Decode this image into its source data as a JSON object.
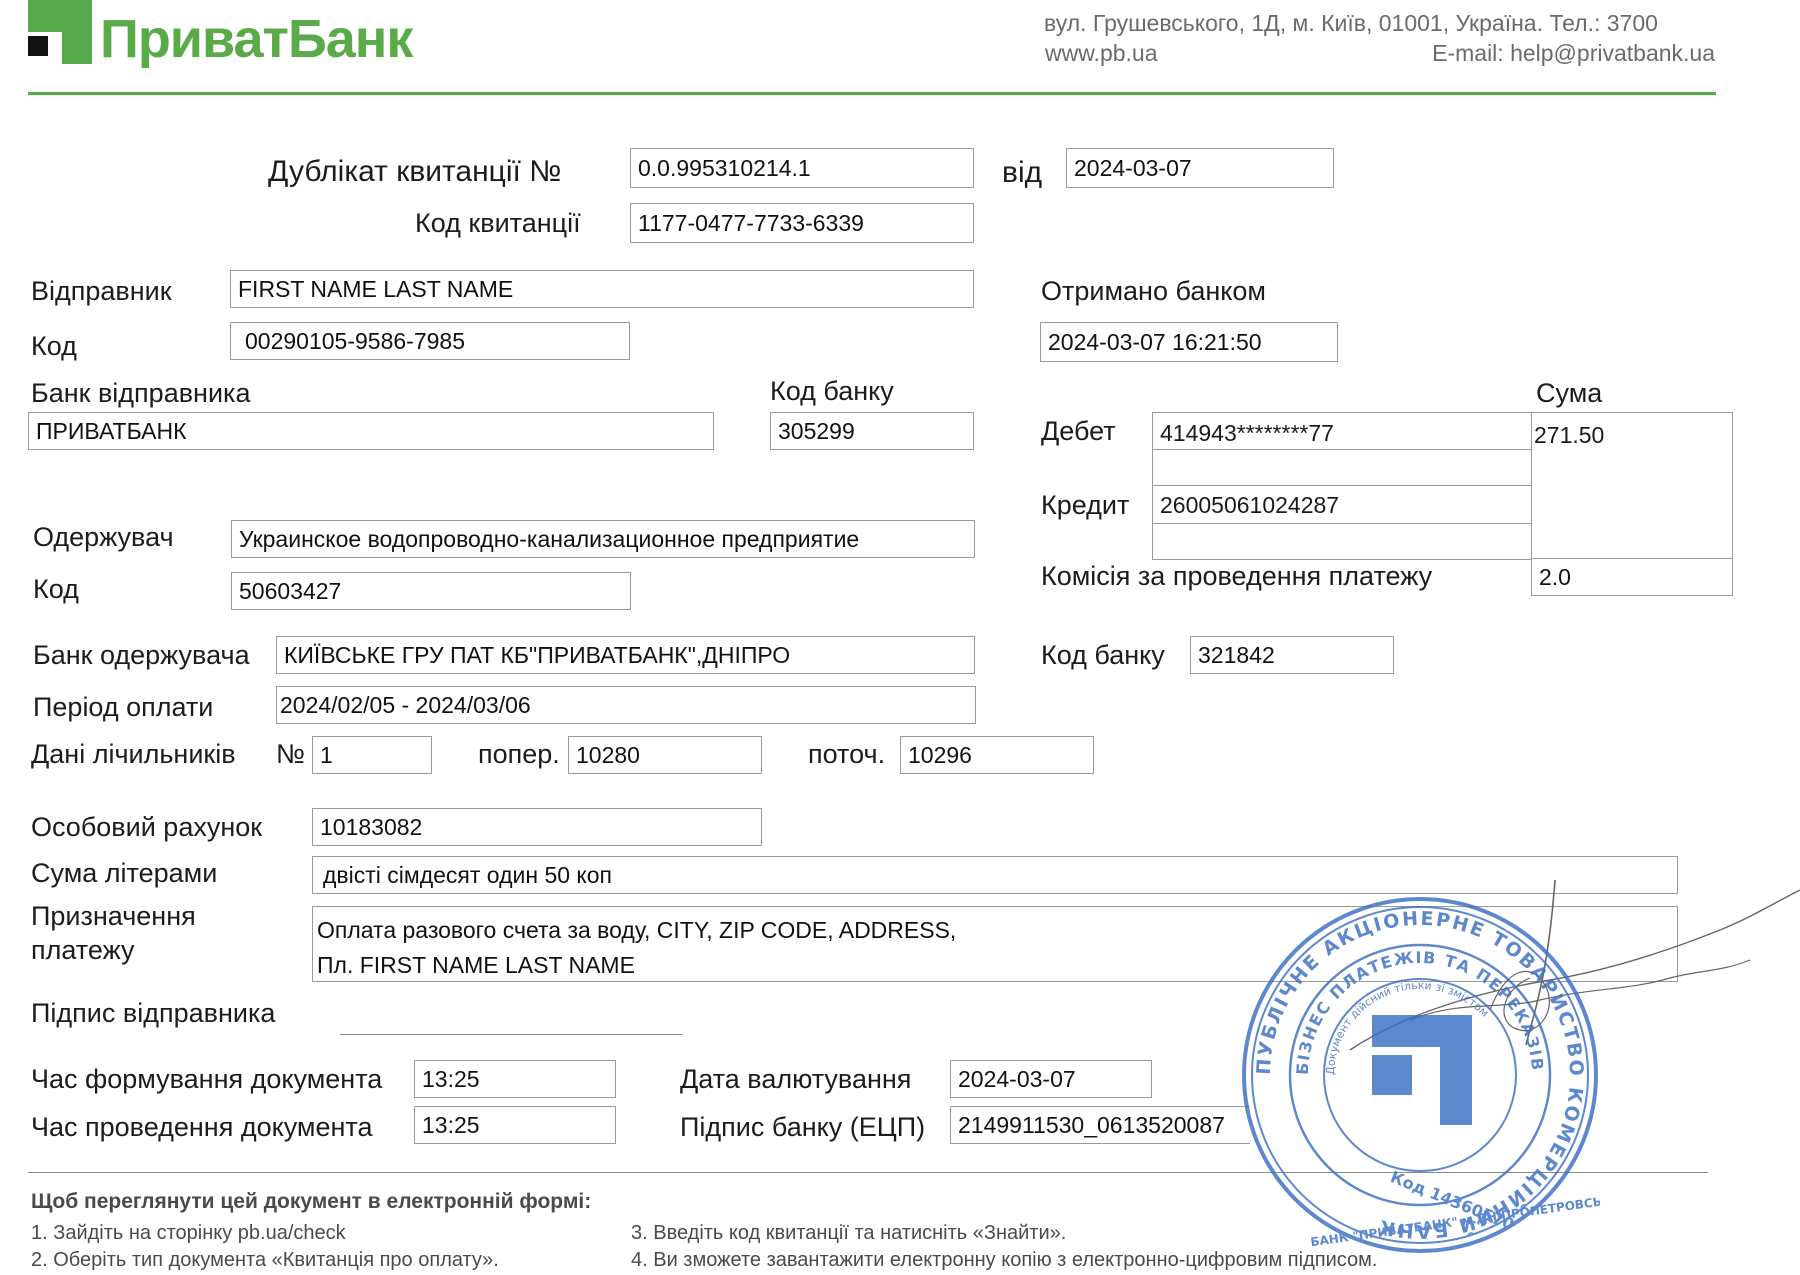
{
  "header": {
    "brand": "ПриватБанк",
    "address": "вул. Грушевського, 1Д, м. Київ, 01001, Україна. Тел.: 3700",
    "website": "www.pb.ua",
    "email": "E-mail: help@privatbank.ua"
  },
  "receipt": {
    "title_label": "Дублікат квитанції №",
    "number": "0.0.995310214.1",
    "from_label": "від",
    "date": "2024-03-07",
    "code_label": "Код квитанції",
    "code": "1177-0477-7733-6339"
  },
  "sender": {
    "label": "Відправник",
    "name": "FIRST NAME LAST NAME",
    "code_label": "Код",
    "code": "00290105-9586-7985",
    "bank_label": "Банк відправника",
    "bank": "ПРИВАТБАНК",
    "bank_code_label": "Код банку",
    "bank_code": "305299"
  },
  "received": {
    "label": "Отримано банком",
    "datetime": "2024-03-07 16:21:50"
  },
  "amounts": {
    "sum_label": "Сума",
    "debit_label": "Дебет",
    "debit": "414943********77",
    "sum": "271.50",
    "credit_label": "Кредит",
    "credit": "26005061024287",
    "commission_label": "Комісія за проведення платежу",
    "commission": "2.0"
  },
  "recipient": {
    "label": "Одержувач",
    "name": "Украинское водопроводно-канализационное предприятие",
    "code_label": "Код",
    "code": "50603427",
    "bank_label": "Банк одержувача",
    "bank": "КИЇВСЬКЕ ГРУ ПАТ КБ\"ПРИВАТБАНК\",ДНІПРО",
    "bank_code_label": "Код банку",
    "bank_code": "321842"
  },
  "payment": {
    "period_label": "Період оплати",
    "period": "2024/02/05 - 2024/03/06",
    "meter_label": "Дані лічильників",
    "meter_no_label": "№",
    "meter_no": "1",
    "prev_label": "попер.",
    "prev": "10280",
    "curr_label": "поточ.",
    "curr": "10296",
    "account_label": "Особовий рахунок",
    "account": "10183082",
    "words_label": "Сума літерами",
    "words": "двісті сімдесят один 50 коп",
    "purpose_label_1": "Призначення",
    "purpose_label_2": "платежу",
    "purpose_line_1": "Оплата разового счета за воду, CITY, ZIP CODE, ADDRESS,",
    "purpose_line_2": "Пл. FIRST NAME LAST NAME",
    "signature_label": "Підпис відправника"
  },
  "timing": {
    "formed_label": "Час формування документа",
    "formed": "13:25",
    "processed_label": "Час проведення документа",
    "processed": "13:25",
    "value_date_label": "Дата валютування",
    "value_date": "2024-03-07",
    "bank_sign_label": "Підпис банку (ЕЦП)",
    "bank_sign": "2149911530_0613520087"
  },
  "footer": {
    "title": "Щоб переглянути цей документ в електронній формі:",
    "step1": "1. Зайдіть на сторінку pb.ua/check",
    "step2": "2. Оберіть тип документа «Квитанція про оплату».",
    "step3": "3. Введіть код квитанції та натисніть «Знайти».",
    "step4": "4. Ви зможете завантажити електронну копію з електронно-цифровим підписом."
  },
  "stamp": {
    "outer_text": "ПУБЛІЧНЕ АКЦІОНЕРНЕ ТОВАРИСТВО КОМЕРЦІЙНИЙ БАНК",
    "ring_text": "БІЗНЕС ПЛАТЕЖІВ ТА ПЕРЕКАЗІВ",
    "inner_text": "Документ дійсний тільки зі змістом",
    "code_text": "Код 14360570",
    "bottom_text": "БАНК \"ПРИВАТБАНК\" м.ДНІПРОПЕТРОВСЬК"
  },
  "colors": {
    "brand_green": "#56a94a",
    "stamp_blue": "#3b6fc4"
  }
}
